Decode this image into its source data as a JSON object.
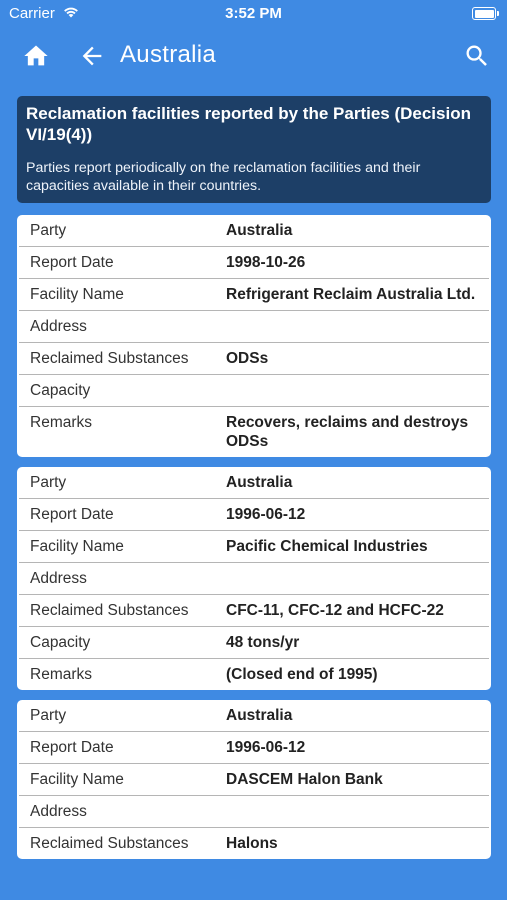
{
  "status": {
    "carrier": "Carrier",
    "time": "3:52 PM"
  },
  "nav": {
    "title": "Australia"
  },
  "banner": {
    "title": "Reclamation facilities reported by the Parties (Decision VI/19(4))",
    "description": "Parties report periodically on the reclamation facilities and their capacities available in their countries."
  },
  "labels": {
    "party": "Party",
    "report_date": "Report Date",
    "facility_name": "Facility Name",
    "address": "Address",
    "reclaimed_substances": "Reclaimed Substances",
    "capacity": "Capacity",
    "remarks": "Remarks"
  },
  "records": [
    {
      "party": "Australia",
      "report_date": "1998-10-26",
      "facility_name": "Refrigerant Reclaim Australia Ltd.",
      "address": "",
      "reclaimed_substances": "ODSs",
      "capacity": "",
      "remarks": "Recovers, reclaims and destroys ODSs"
    },
    {
      "party": "Australia",
      "report_date": "1996-06-12",
      "facility_name": "Pacific Chemical Industries",
      "address": "",
      "reclaimed_substances": "CFC-11, CFC-12 and HCFC-22",
      "capacity": "48 tons/yr",
      "remarks": "(Closed end of 1995)"
    },
    {
      "party": "Australia",
      "report_date": "1996-06-12",
      "facility_name": "DASCEM Halon Bank",
      "address": "",
      "reclaimed_substances": "Halons"
    }
  ]
}
